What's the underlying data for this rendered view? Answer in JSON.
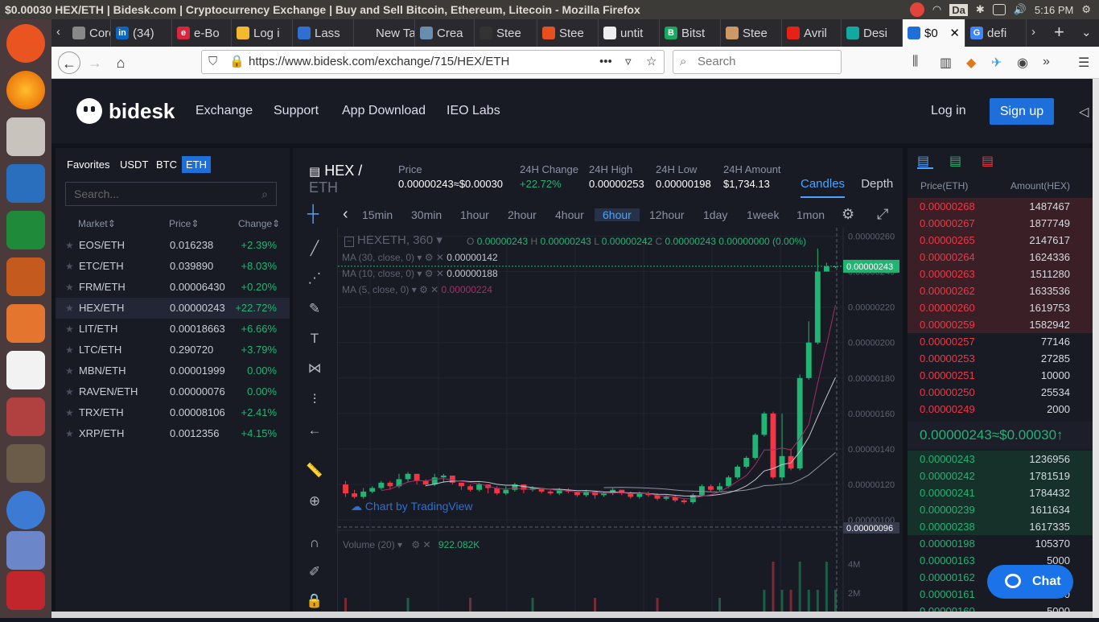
{
  "os": {
    "window_title": "$0.00030 HEX/ETH | Bidesk.com | Cryptocurrency Exchange | Buy and Sell Bitcoin, Ethereum, Litecoin - Mozilla Firefox",
    "time": "5:16 PM",
    "da_badge": "Da"
  },
  "browser": {
    "tabs": [
      {
        "label": "Coro",
        "color": "#888"
      },
      {
        "label": "(34)",
        "color": "#0a66c2",
        "glyph": "in"
      },
      {
        "label": "e-Bo",
        "color": "#d7263d",
        "glyph": "e"
      },
      {
        "label": "Log i",
        "color": "#f3ba2f"
      },
      {
        "label": "Lass",
        "color": "#2f6fd1"
      },
      {
        "label": "New Tal",
        "color": "none"
      },
      {
        "label": "Crea",
        "color": "#6a8caf"
      },
      {
        "label": "Stee",
        "color": "#333"
      },
      {
        "label": "Stee",
        "color": "#e6501e"
      },
      {
        "label": "untit",
        "color": "#eee"
      },
      {
        "label": "Bitst",
        "color": "#1aa85f",
        "glyph": "B"
      },
      {
        "label": "Stee",
        "color": "#c96"
      },
      {
        "label": "Avril",
        "color": "#e62117"
      },
      {
        "label": "Desi",
        "color": "#11aaa0"
      },
      {
        "label": "$0",
        "color": "#1e6fd9",
        "active": true
      },
      {
        "label": "defi",
        "color": "#4285f4",
        "glyph": "G"
      }
    ],
    "url": "https://www.bidesk.com/exchange/715/HEX/ETH",
    "url_host": "bidesk.com",
    "search_placeholder": "Search"
  },
  "site": {
    "brand": "bidesk",
    "nav": [
      "Exchange",
      "Support",
      "App Download",
      "IEO Labs"
    ],
    "login": "Log in",
    "signup": "Sign up"
  },
  "market": {
    "tabs": [
      "Favorites",
      "USDT",
      "BTC",
      "ETH"
    ],
    "active_tab": "ETH",
    "search_placeholder": "Search...",
    "headers": [
      "Market",
      "Price",
      "Change"
    ],
    "rows": [
      {
        "name": "EOS/ETH",
        "price": "0.016238",
        "change": "+2.39%"
      },
      {
        "name": "ETC/ETH",
        "price": "0.039890",
        "change": "+8.03%"
      },
      {
        "name": "FRM/ETH",
        "price": "0.00006430",
        "change": "+0.20%"
      },
      {
        "name": "HEX/ETH",
        "price": "0.00000243",
        "change": "+22.72%",
        "selected": true
      },
      {
        "name": "LIT/ETH",
        "price": "0.00018663",
        "change": "+6.66%"
      },
      {
        "name": "LTC/ETH",
        "price": "0.290720",
        "change": "+3.79%"
      },
      {
        "name": "MBN/ETH",
        "price": "0.00001999",
        "change": "0.00%"
      },
      {
        "name": "RAVEN/ETH",
        "price": "0.00000076",
        "change": "0.00%"
      },
      {
        "name": "TRX/ETH",
        "price": "0.00008106",
        "change": "+2.41%"
      },
      {
        "name": "XRP/ETH",
        "price": "0.0012356",
        "change": "+4.15%"
      }
    ]
  },
  "ticker": {
    "pair_base": "HEX /",
    "pair_quote": "ETH",
    "price_label": "Price",
    "price": "0.00000243≈$0.00030",
    "change_label": "24H Change",
    "change": "+22.72%",
    "high_label": "24H High",
    "high": "0.00000253",
    "low_label": "24H Low",
    "low": "0.00000198",
    "amount_label": "24H Amount",
    "amount": "$1,734.13",
    "view_tabs": [
      "Candles",
      "Depth"
    ]
  },
  "timeframes": [
    "15min",
    "30min",
    "1hour",
    "2hour",
    "4hour",
    "6hour",
    "12hour",
    "1day",
    "1week",
    "1mon"
  ],
  "active_timeframe": "6hour",
  "chart": {
    "symbol": "HEXETH, 360",
    "ohlc": {
      "o": "0.00000243",
      "h": "0.00000243",
      "l": "0.00000242",
      "c": "0.00000243",
      "chg": "0.00000000 (0.00%)"
    },
    "ma": [
      {
        "label": "MA (30, close, 0)",
        "value": "0.00000142",
        "color": "#c3c6cf"
      },
      {
        "label": "MA (10, close, 0)",
        "value": "0.00000188",
        "color": "#c3c6cf"
      },
      {
        "label": "MA (5, close, 0)",
        "value": "0.00000224",
        "color": "#a0306a"
      }
    ],
    "volume_label": "Volume (20)",
    "volume_value": "922.082K",
    "watermark": "Chart by TradingView",
    "price_axis": [
      "0.00000260",
      "0.00000240",
      "0.00000220",
      "0.00000200",
      "0.00000180",
      "0.00000160",
      "0.00000140",
      "0.00000120",
      "0.00000100"
    ],
    "current_tag": "0.00000243",
    "low_tag": "0.00000096",
    "vol_axis": [
      "4M",
      "2M"
    ]
  },
  "chart_data": {
    "type": "candlestick",
    "ylim": [
      9.6e-07,
      2.62e-06
    ],
    "candles": [
      [
        1.2,
        1.15,
        1.22,
        1.13
      ],
      [
        1.15,
        1.13,
        1.17,
        1.12
      ],
      [
        1.13,
        1.16,
        1.18,
        1.12
      ],
      [
        1.16,
        1.18,
        1.19,
        1.15
      ],
      [
        1.18,
        1.21,
        1.22,
        1.17
      ],
      [
        1.21,
        1.19,
        1.22,
        1.17
      ],
      [
        1.19,
        1.23,
        1.26,
        1.18
      ],
      [
        1.23,
        1.26,
        1.27,
        1.21
      ],
      [
        1.26,
        1.22,
        1.26,
        1.2
      ],
      [
        1.22,
        1.2,
        1.23,
        1.19
      ],
      [
        1.2,
        1.24,
        1.26,
        1.19
      ],
      [
        1.24,
        1.25,
        1.26,
        1.21
      ],
      [
        1.25,
        1.21,
        1.25,
        1.2
      ],
      [
        1.21,
        1.19,
        1.21,
        1.17
      ],
      [
        1.19,
        1.17,
        1.2,
        1.16
      ],
      [
        1.17,
        1.2,
        1.21,
        1.16
      ],
      [
        1.2,
        1.18,
        1.2,
        1.15
      ],
      [
        1.18,
        1.15,
        1.19,
        1.14
      ],
      [
        1.15,
        1.17,
        1.19,
        1.14
      ],
      [
        1.17,
        1.2,
        1.21,
        1.16
      ],
      [
        1.2,
        1.17,
        1.2,
        1.15
      ],
      [
        1.17,
        1.18,
        1.19,
        1.16
      ],
      [
        1.18,
        1.16,
        1.18,
        1.15
      ],
      [
        1.16,
        1.15,
        1.17,
        1.14
      ],
      [
        1.15,
        1.17,
        1.18,
        1.14
      ],
      [
        1.17,
        1.16,
        1.18,
        1.15
      ],
      [
        1.16,
        1.14,
        1.16,
        1.13
      ],
      [
        1.14,
        1.16,
        1.17,
        1.13
      ],
      [
        1.16,
        1.14,
        1.16,
        1.12
      ],
      [
        1.14,
        1.15,
        1.16,
        1.13
      ],
      [
        1.15,
        1.17,
        1.18,
        1.14
      ],
      [
        1.17,
        1.15,
        1.17,
        1.14
      ],
      [
        1.15,
        1.13,
        1.16,
        1.12
      ],
      [
        1.13,
        1.15,
        1.16,
        1.12
      ],
      [
        1.15,
        1.14,
        1.16,
        1.13
      ],
      [
        1.14,
        1.12,
        1.15,
        1.11
      ],
      [
        1.12,
        1.13,
        1.14,
        1.11
      ],
      [
        1.13,
        1.11,
        1.14,
        1.1
      ],
      [
        1.11,
        1.1,
        1.12,
        1.09
      ],
      [
        1.1,
        1.14,
        1.15,
        1.09
      ],
      [
        1.14,
        1.19,
        1.2,
        1.13
      ],
      [
        1.19,
        1.17,
        1.2,
        1.16
      ],
      [
        1.17,
        1.19,
        1.21,
        1.16
      ],
      [
        1.19,
        1.24,
        1.25,
        1.18
      ],
      [
        1.24,
        1.3,
        1.31,
        1.23
      ],
      [
        1.3,
        1.35,
        1.36,
        1.29
      ],
      [
        1.35,
        1.48,
        1.49,
        1.34
      ],
      [
        1.48,
        1.6,
        1.61,
        1.47
      ],
      [
        1.6,
        1.24,
        1.61,
        1.23
      ],
      [
        1.24,
        1.36,
        1.6,
        1.22
      ],
      [
        1.36,
        1.29,
        1.4,
        1.28
      ],
      [
        1.29,
        1.8,
        1.82,
        1.28
      ],
      [
        1.8,
        2.0,
        2.12,
        1.79
      ],
      [
        2.0,
        2.4,
        2.53,
        1.99
      ],
      [
        2.4,
        2.43,
        2.45,
        2.41
      ],
      [
        2.43,
        2.43,
        2.43,
        2.42
      ]
    ],
    "ma5_last": 2.24e-06,
    "ma10_last": 1.88e-06,
    "ma30_last": 1.42e-06
  },
  "orderbook": {
    "headers": [
      "Price(ETH)",
      "Amount(HEX)"
    ],
    "asks": [
      {
        "p": "0.00000268",
        "a": "1487467"
      },
      {
        "p": "0.00000267",
        "a": "1877749"
      },
      {
        "p": "0.00000265",
        "a": "2147617"
      },
      {
        "p": "0.00000264",
        "a": "1624336"
      },
      {
        "p": "0.00000263",
        "a": "1511280"
      },
      {
        "p": "0.00000262",
        "a": "1633536"
      },
      {
        "p": "0.00000260",
        "a": "1619753"
      },
      {
        "p": "0.00000259",
        "a": "1582942"
      },
      {
        "p": "0.00000257",
        "a": "77146"
      },
      {
        "p": "0.00000253",
        "a": "27285"
      },
      {
        "p": "0.00000251",
        "a": "10000"
      },
      {
        "p": "0.00000250",
        "a": "25534"
      },
      {
        "p": "0.00000249",
        "a": "2000"
      }
    ],
    "last": "0.00000243≈$0.00030↑",
    "bids": [
      {
        "p": "0.00000243",
        "a": "1236956"
      },
      {
        "p": "0.00000242",
        "a": "1781519"
      },
      {
        "p": "0.00000241",
        "a": "1784432"
      },
      {
        "p": "0.00000239",
        "a": "1611634"
      },
      {
        "p": "0.00000238",
        "a": "1617335"
      },
      {
        "p": "0.00000198",
        "a": "105370"
      },
      {
        "p": "0.00000163",
        "a": "5000"
      },
      {
        "p": "0.00000162",
        "a": "5000"
      },
      {
        "p": "0.00000161",
        "a": "5000"
      },
      {
        "p": "0.00000160",
        "a": "5000"
      }
    ]
  },
  "chat_label": "Chat"
}
